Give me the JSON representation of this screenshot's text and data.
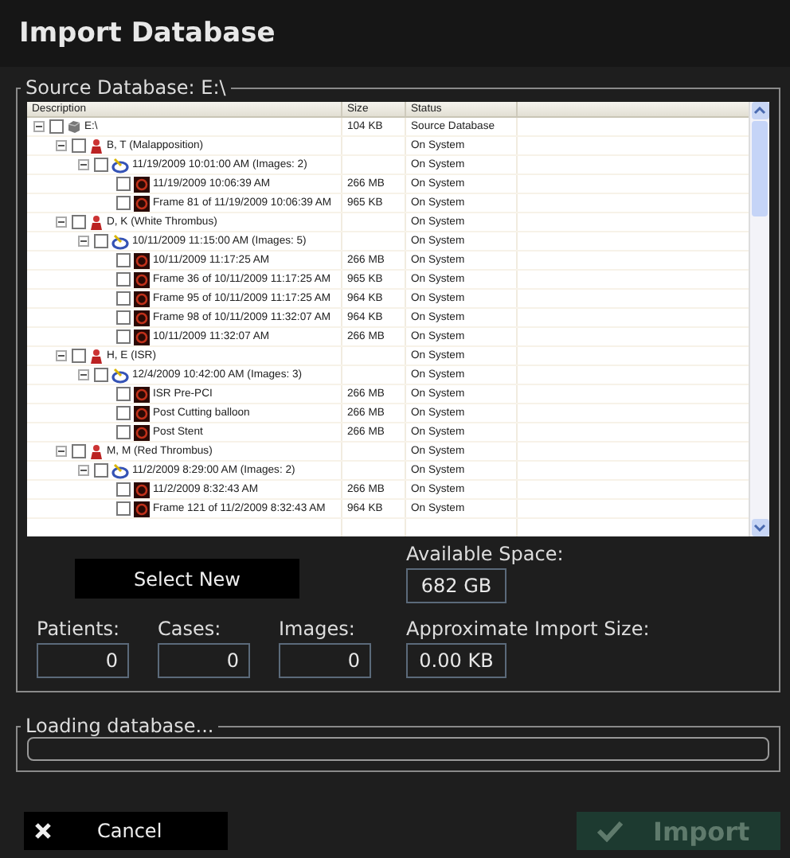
{
  "window": {
    "title": "Import Database"
  },
  "source": {
    "legend": "Source Database: E:\\",
    "columns": [
      "Description",
      "Size",
      "Status"
    ],
    "tree": [
      {
        "kind": "drive",
        "label": "E:\\",
        "size": "104 KB",
        "status": "Source Database",
        "checked": false,
        "expanded": true,
        "children": [
          {
            "kind": "patient",
            "label": "B, T (Malapposition)",
            "status": "On System",
            "checked": false,
            "expanded": true,
            "children": [
              {
                "kind": "case",
                "label": "11/19/2009 10:01:00 AM (Images: 2)",
                "status": "On System",
                "checked": false,
                "expanded": true,
                "children": [
                  {
                    "kind": "image",
                    "label": "11/19/2009 10:06:39 AM",
                    "size": "266 MB",
                    "status": "On System",
                    "checked": false
                  },
                  {
                    "kind": "image",
                    "label": "Frame 81 of 11/19/2009 10:06:39 AM",
                    "size": "965 KB",
                    "status": "On System",
                    "checked": false
                  }
                ]
              }
            ]
          },
          {
            "kind": "patient",
            "label": "D, K (White Thrombus)",
            "status": "On System",
            "checked": false,
            "expanded": true,
            "children": [
              {
                "kind": "case",
                "label": "10/11/2009 11:15:00 AM (Images: 5)",
                "status": "On System",
                "checked": false,
                "expanded": true,
                "children": [
                  {
                    "kind": "image",
                    "label": "10/11/2009 11:17:25 AM",
                    "size": "266 MB",
                    "status": "On System",
                    "checked": false
                  },
                  {
                    "kind": "image",
                    "label": "Frame 36 of 10/11/2009 11:17:25 AM",
                    "size": "965 KB",
                    "status": "On System",
                    "checked": false
                  },
                  {
                    "kind": "image",
                    "label": "Frame 95 of 10/11/2009 11:17:25 AM",
                    "size": "964 KB",
                    "status": "On System",
                    "checked": false
                  },
                  {
                    "kind": "image",
                    "label": "Frame 98 of 10/11/2009 11:32:07 AM",
                    "size": "964 KB",
                    "status": "On System",
                    "checked": false
                  },
                  {
                    "kind": "image",
                    "label": "10/11/2009 11:32:07 AM",
                    "size": "266 MB",
                    "status": "On System",
                    "checked": false
                  }
                ]
              }
            ]
          },
          {
            "kind": "patient",
            "label": "H, E (ISR)",
            "status": "On System",
            "checked": false,
            "expanded": true,
            "children": [
              {
                "kind": "case",
                "label": "12/4/2009 10:42:00 AM (Images: 3)",
                "status": "On System",
                "checked": false,
                "expanded": true,
                "children": [
                  {
                    "kind": "image",
                    "label": "ISR Pre-PCI",
                    "size": "266 MB",
                    "status": "On System",
                    "checked": false
                  },
                  {
                    "kind": "image",
                    "label": "Post Cutting balloon",
                    "size": "266 MB",
                    "status": "On System",
                    "checked": false
                  },
                  {
                    "kind": "image",
                    "label": "Post Stent",
                    "size": "266 MB",
                    "status": "On System",
                    "checked": false
                  }
                ]
              }
            ]
          },
          {
            "kind": "patient",
            "label": "M, M (Red Thrombus)",
            "status": "On System",
            "checked": false,
            "expanded": true,
            "children": [
              {
                "kind": "case",
                "label": "11/2/2009 8:29:00 AM (Images: 2)",
                "status": "On System",
                "checked": false,
                "expanded": true,
                "children": [
                  {
                    "kind": "image",
                    "label": "11/2/2009 8:32:43 AM",
                    "size": "266 MB",
                    "status": "On System",
                    "checked": false
                  },
                  {
                    "kind": "image",
                    "label": "Frame 121 of 11/2/2009 8:32:43 AM",
                    "size": "964 KB",
                    "status": "On System",
                    "checked": false
                  }
                ]
              }
            ]
          }
        ]
      }
    ]
  },
  "select_button": "Select New",
  "available": {
    "label": "Available Space:",
    "value": "682 GB"
  },
  "counts": [
    {
      "label": "Patients:",
      "value": "0"
    },
    {
      "label": "Cases:",
      "value": "0"
    },
    {
      "label": "Images:",
      "value": "0"
    }
  ],
  "import_size": {
    "label": "Approximate Import Size:",
    "value": "0.00 KB"
  },
  "loading": {
    "legend": "Loading database...",
    "level": 0
  },
  "cancel_button": {
    "label": "Cancel"
  },
  "import_button": {
    "label": "Import",
    "disabled": true
  }
}
